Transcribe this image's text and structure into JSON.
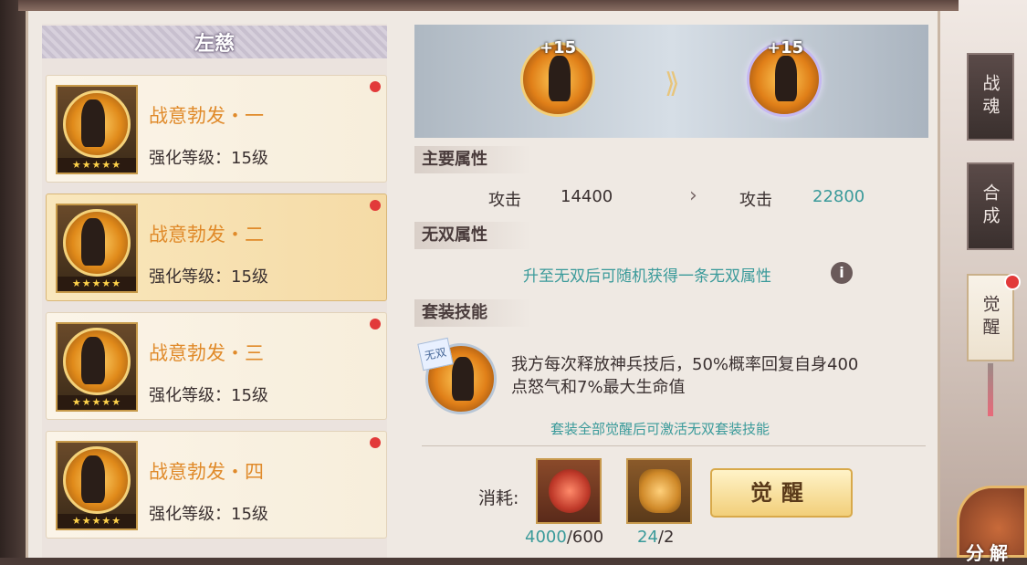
{
  "left_panel": {
    "title": "左慈",
    "items": [
      {
        "name": "战意勃发・一",
        "level": "强化等级：15级",
        "stars": "★★★★★",
        "has_red_dot": true,
        "selected": false
      },
      {
        "name": "战意勃发・二",
        "level": "强化等级：15级",
        "stars": "★★★★★",
        "has_red_dot": true,
        "selected": true
      },
      {
        "name": "战意勃发・三",
        "level": "强化等级：15级",
        "stars": "★★★★★",
        "has_red_dot": true,
        "selected": false
      },
      {
        "name": "战意勃发・四",
        "level": "强化等级：15级",
        "stars": "★★★★★",
        "has_red_dot": true,
        "selected": false
      }
    ]
  },
  "preview": {
    "before_plus": "+15",
    "after_plus": "+15"
  },
  "main_attr": {
    "heading": "主要属性",
    "before_label": "攻击",
    "before_value": "14400",
    "arrow": "›",
    "after_label": "攻击",
    "after_value": "22800"
  },
  "wushuang_attr": {
    "heading": "无双属性",
    "text": "升至无双后可随机获得一条无双属性"
  },
  "set_skill": {
    "heading": "套装技能",
    "tag": "无双",
    "description_line1": "我方每次释放神兵技后，50%概率回复自身400",
    "description_line2": "点怒气和7%最大生命值",
    "note": "套装全部觉醒后可激活无双套装技能"
  },
  "cost": {
    "label": "消耗:",
    "item1_have": "4000",
    "item1_need": "/600",
    "item2_have": "24",
    "item2_need": "/2"
  },
  "awaken_button": "觉醒",
  "side_tabs": [
    "战魂",
    "合成",
    "觉醒"
  ],
  "decompose_label": "分解",
  "colors": {
    "accent_orange": "#e08a2a",
    "teal_value": "#3a9a9a",
    "red_dot": "#e23a3a"
  },
  "icons": {
    "info": "info-icon",
    "arrow": "double-chevron-icon"
  }
}
